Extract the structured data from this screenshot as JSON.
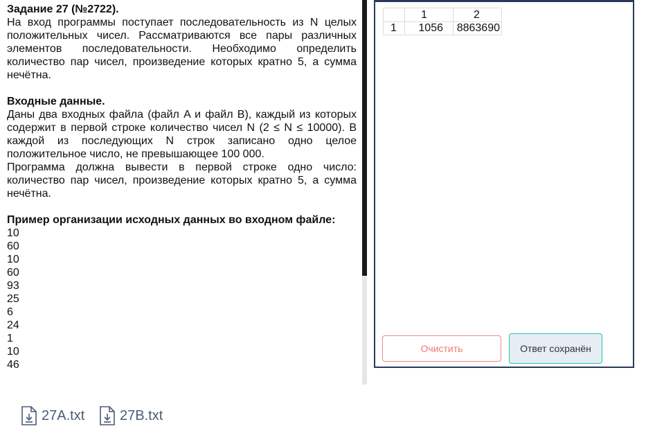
{
  "task": {
    "title": "Задание 27 (№2722).",
    "intro": "На вход программы поступает последовательность из N целых положительных чисел. Рассматриваются все пары различных элементов последовательности. Необходимо определить количество пар чисел, произведение которых кратно 5, а сумма нечётна.",
    "input_heading": "Входные данные.",
    "input_text": "Даны два входных файла (файл A и файл B), каждый из которых содержит в первой строке количество чисел N (2 ≤ N ≤ 10000). В каждой из последующих N строк записано одно целое положительное число, не превышающее 100 000.",
    "output_text": "Программа должна вывести в первой строке одно число: количество пар чисел, произведение которых кратно 5, а сумма нечётна.",
    "example_heading": "Пример организации исходных данных во входном файле:",
    "example_numbers": [
      "10",
      "60",
      "10",
      "60",
      "93",
      "25",
      "6",
      "24",
      "1",
      "10",
      "46"
    ]
  },
  "answer_table": {
    "col_headers": [
      "1",
      "2"
    ],
    "row_header": "1",
    "values": [
      "1056",
      "8863690"
    ]
  },
  "buttons": {
    "clear": "Очистить",
    "saved": "Ответ сохранён"
  },
  "files": [
    {
      "name": "27A.txt",
      "icon": "download-file-icon"
    },
    {
      "name": "27B.txt",
      "icon": "download-file-icon"
    }
  ],
  "colors": {
    "panel_border": "#27385a",
    "clear_border": "#e88a8a",
    "saved_border": "#1fc8a8",
    "file_link": "#4a5a78"
  }
}
